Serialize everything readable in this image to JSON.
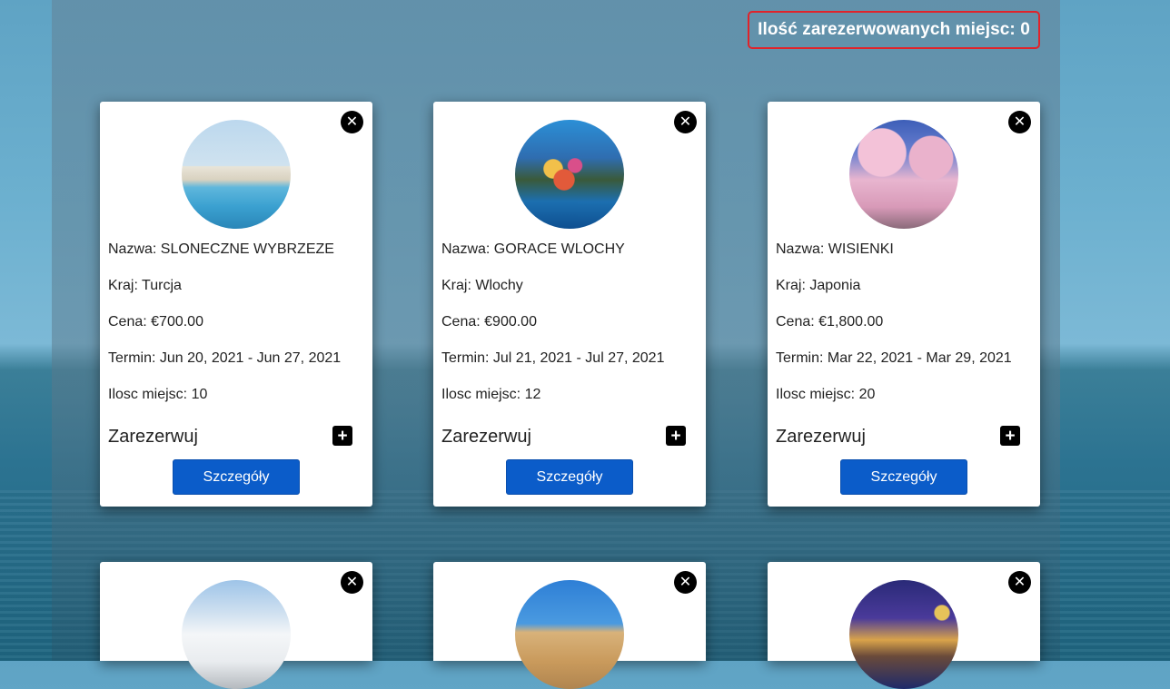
{
  "header": {
    "reserved_label": "Ilość zarezerwowanych miejsc: 0"
  },
  "cards": [
    {
      "image": "turkey-resort-thumbnail",
      "name": "Nazwa: SLONECZNE WYBRZEZE",
      "country": "Kraj: Turcja",
      "price": "Cena: €700.00",
      "term": "Termin: Jun 20, 2021 - Jun 27, 2021",
      "seats": "Ilosc miejsc: 10",
      "reserve_label": "Zarezerwuj",
      "details_label": "Szczegóły"
    },
    {
      "image": "italy-coast-thumbnail",
      "name": "Nazwa: GORACE WLOCHY",
      "country": "Kraj: Wlochy",
      "price": "Cena: €900.00",
      "term": "Termin: Jul 21, 2021 - Jul 27, 2021",
      "seats": "Ilosc miejsc: 12",
      "reserve_label": "Zarezerwuj",
      "details_label": "Szczegóły"
    },
    {
      "image": "japan-castle-thumbnail",
      "name": "Nazwa: WISIENKI",
      "country": "Kraj: Japonia",
      "price": "Cena: €1,800.00",
      "term": "Termin: Mar 22, 2021 - Mar 29, 2021",
      "seats": "Ilosc miejsc: 20",
      "reserve_label": "Zarezerwuj",
      "details_label": "Szczegóły"
    },
    {
      "image": "snow-mountain-thumbnail"
    },
    {
      "image": "greece-temple-thumbnail"
    },
    {
      "image": "london-night-thumbnail"
    }
  ],
  "icons": {
    "close": "close-circle-icon",
    "add": "plus-square-icon"
  },
  "colors": {
    "counter_border": "#e0232a",
    "details_button": "#0b5cc9"
  }
}
